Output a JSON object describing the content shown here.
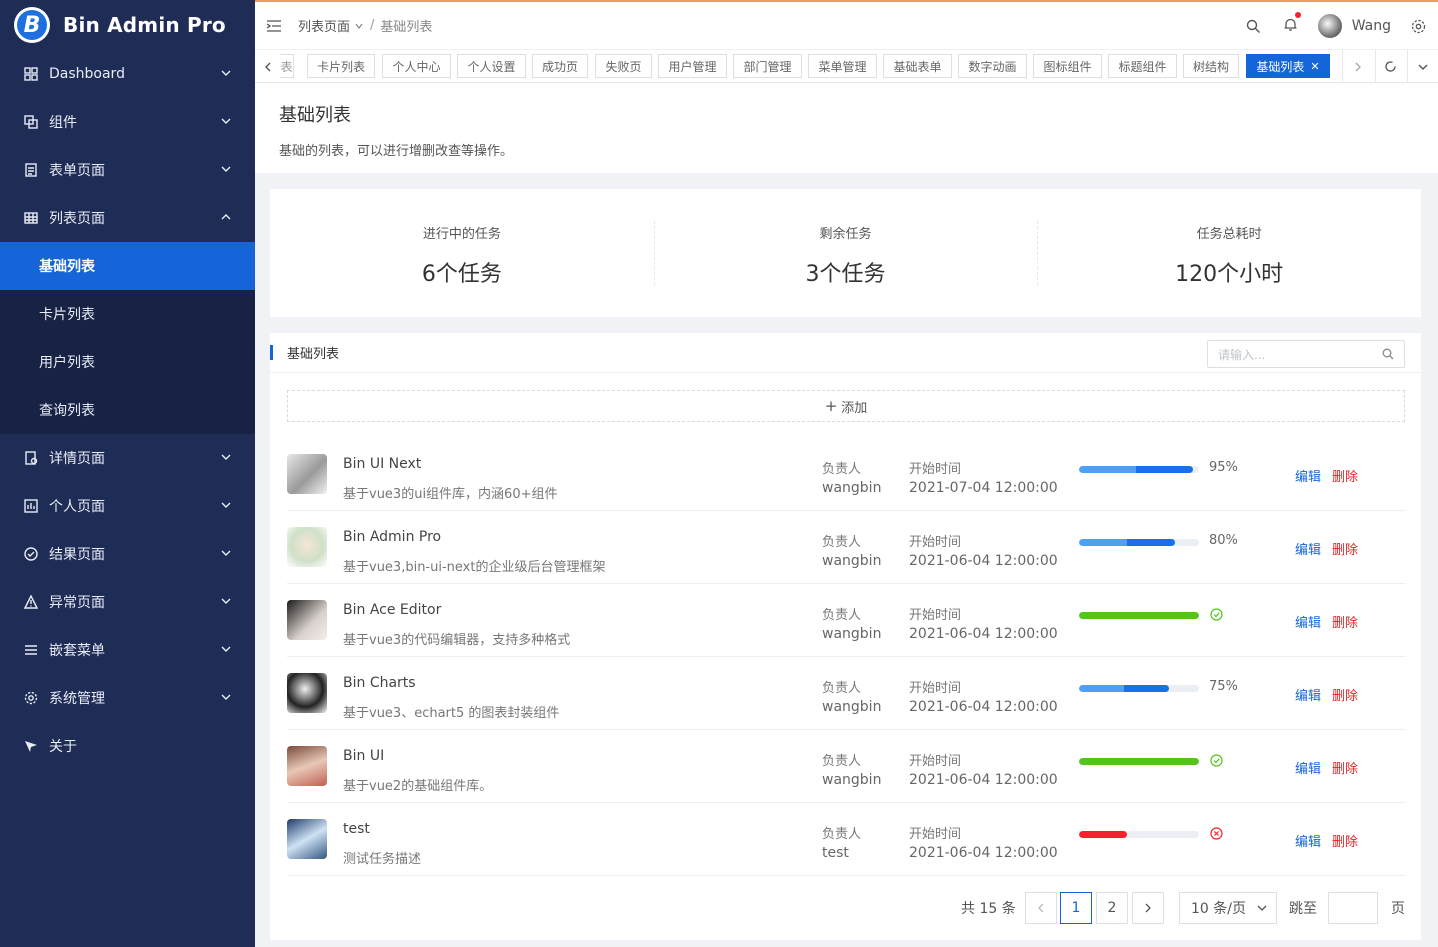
{
  "app": {
    "name": "Bin Admin Pro",
    "logo_letter": "B"
  },
  "sidebar": {
    "items": [
      {
        "label": "Dashboard"
      },
      {
        "label": "组件"
      },
      {
        "label": "表单页面"
      },
      {
        "label": "列表页面"
      },
      {
        "label": "详情页面"
      },
      {
        "label": "个人页面"
      },
      {
        "label": "结果页面"
      },
      {
        "label": "异常页面"
      },
      {
        "label": "嵌套菜单"
      },
      {
        "label": "系统管理"
      },
      {
        "label": "关于"
      }
    ],
    "sub_items": [
      {
        "label": "基础列表",
        "active": true
      },
      {
        "label": "卡片列表"
      },
      {
        "label": "用户列表"
      },
      {
        "label": "查询列表"
      }
    ]
  },
  "header": {
    "breadcrumb": [
      "列表页面",
      "基础列表"
    ],
    "username": "Wang"
  },
  "tabs": {
    "first_partial": "表",
    "items": [
      "卡片列表",
      "个人中心",
      "个人设置",
      "成功页",
      "失败页",
      "用户管理",
      "部门管理",
      "菜单管理",
      "基础表单",
      "数字动画",
      "图标组件",
      "标题组件",
      "树结构"
    ],
    "active": "基础列表",
    "close_glyph": "✕"
  },
  "page": {
    "title": "基础列表",
    "description": "基础的列表，可以进行增删改查等操作。"
  },
  "stats": [
    {
      "label": "进行中的任务",
      "value": "6个任务"
    },
    {
      "label": "剩余任务",
      "value": "3个任务"
    },
    {
      "label": "任务总耗时",
      "value": "120个小时"
    }
  ],
  "list": {
    "title": "基础列表",
    "search_placeholder": "请输入...",
    "add_label": "添加",
    "add_glyph": "+",
    "owner_label": "负责人",
    "time_label": "开始时间",
    "edit_label": "编辑",
    "delete_label": "删除",
    "rows": [
      {
        "title": "Bin UI Next",
        "desc": "基于vue3的ui组件库，内涵60+组件",
        "owner": "wangbin",
        "time": "2021-07-04 12:00:00",
        "progress": 95,
        "status": "active",
        "progress_text": "95%"
      },
      {
        "title": "Bin Admin Pro",
        "desc": "基于vue3,bin-ui-next的企业级后台管理框架",
        "owner": "wangbin",
        "time": "2021-06-04 12:00:00",
        "progress": 80,
        "status": "active",
        "progress_text": "80%"
      },
      {
        "title": "Bin Ace Editor",
        "desc": "基于vue3的代码编辑器，支持多种格式",
        "owner": "wangbin",
        "time": "2021-06-04 12:00:00",
        "progress": 100,
        "status": "success",
        "progress_text": ""
      },
      {
        "title": "Bin Charts",
        "desc": "基于vue3、echart5 的图表封装组件",
        "owner": "wangbin",
        "time": "2021-06-04 12:00:00",
        "progress": 75,
        "status": "active",
        "progress_text": "75%"
      },
      {
        "title": "Bin UI",
        "desc": "基于vue2的基础组件库。",
        "owner": "wangbin",
        "time": "2021-06-04 12:00:00",
        "progress": 100,
        "status": "success",
        "progress_text": ""
      },
      {
        "title": "test",
        "desc": "测试任务描述",
        "owner": "test",
        "time": "2021-06-04 12:00:00",
        "progress": 40,
        "status": "exception",
        "progress_text": ""
      }
    ]
  },
  "pagination": {
    "total_text": "共 15 条",
    "pages": [
      "1",
      "2"
    ],
    "current": "1",
    "page_size": "10 条/页",
    "jump_label": "跳至",
    "page_unit": "页"
  },
  "colors": {
    "sidebar_bg": "#1f2d56",
    "accent": "#1565d8",
    "success": "#52c41a",
    "danger": "#e02424"
  }
}
